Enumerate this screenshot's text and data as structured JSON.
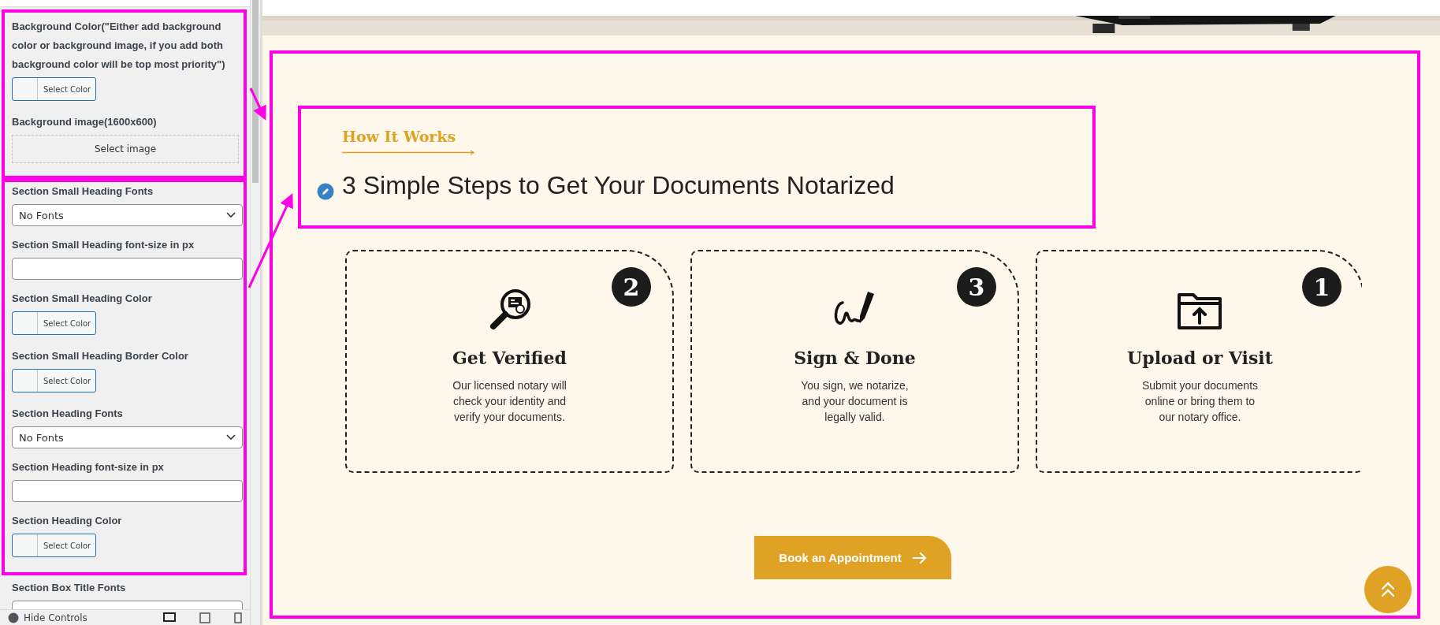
{
  "sidebar": {
    "groups": [
      {
        "highlighted": true,
        "fields": [
          {
            "kind": "color",
            "label": "Background Color(\"Either add background color or background image, if you add both background color will be top most priority\")",
            "button": "Select Color"
          },
          {
            "label": "Background image(1600x600)",
            "button": "Select image"
          }
        ]
      },
      {
        "highlighted": true,
        "fields": [
          {
            "kind": "select",
            "label": "Section Small Heading Fonts",
            "value": "No Fonts"
          },
          {
            "kind": "input",
            "label": "Section Small Heading font-size in px"
          },
          {
            "kind": "color",
            "label": "Section Small Heading Color",
            "button": "Select Color"
          },
          {
            "kind": "color",
            "label": "Section Small Heading Border Color",
            "button": "Select Color"
          },
          {
            "kind": "select",
            "label": "Section Heading Fonts",
            "value": "No Fonts"
          },
          {
            "kind": "input",
            "label": "Section Heading font-size in px"
          },
          {
            "kind": "color",
            "label": "Section Heading Color",
            "button": "Select Color"
          }
        ]
      },
      {
        "highlighted": false,
        "fields": [
          {
            "kind": "select",
            "label": "Section Box Title Fonts"
          }
        ]
      }
    ],
    "footer": {
      "label": "Hide Controls"
    }
  },
  "section": {
    "highlighted": true,
    "heading_highlighted": true,
    "small_heading": "How It Works",
    "heading": "3 Simple Steps to Get Your Documents Notarized",
    "steps": [
      {
        "kind": "verify",
        "number": "2",
        "title": "Get Verified",
        "lines": [
          "Our licensed notary will",
          "check your identity and",
          "verify your documents."
        ]
      },
      {
        "kind": "sign",
        "number": "3",
        "title": "Sign & Done",
        "lines": [
          "You sign, we notarize,",
          "and your document is",
          "legally valid."
        ]
      },
      {
        "kind": "upload",
        "number": "1",
        "title": "Upload or Visit",
        "lines": [
          "Submit your documents",
          "online or bring them to",
          "our notary office."
        ]
      }
    ],
    "button": "Book an Appointment"
  }
}
